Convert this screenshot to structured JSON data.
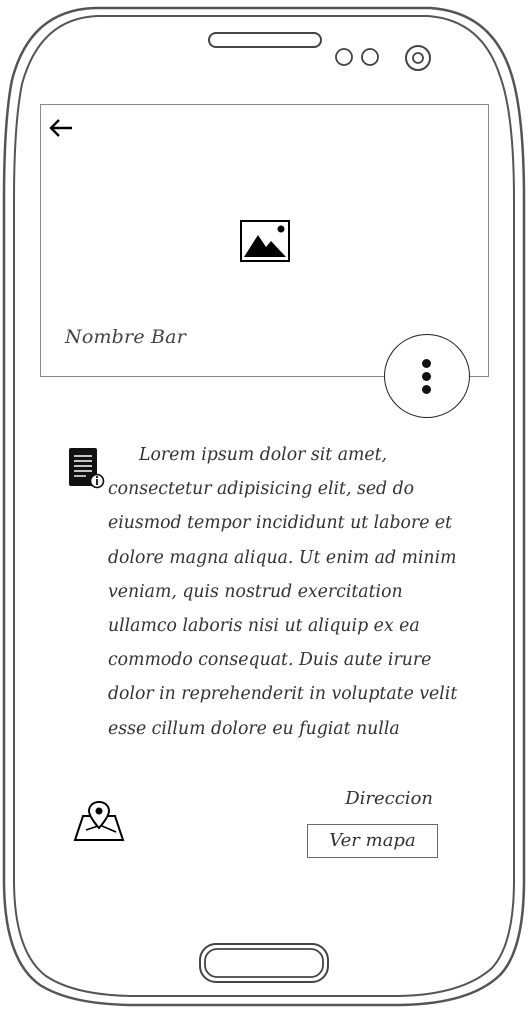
{
  "header": {
    "back_icon": "arrow-left-icon",
    "image_icon": "image-placeholder-icon",
    "title": "Nombre Bar"
  },
  "fab": {
    "icon": "more-vertical-icon"
  },
  "description": {
    "icon": "document-info-icon",
    "text": "Lorem ipsum dolor sit amet, consectetur adipisicing elit, sed do eiusmod tempor incididunt ut labore et dolore magna aliqua. Ut enim ad minim veniam, quis nostrud exercitation ullamco laboris nisi ut aliquip ex ea commodo consequat. Duis aute irure dolor in reprehenderit in voluptate velit esse cillum dolore eu fugiat nulla"
  },
  "location": {
    "icon": "map-pin-icon",
    "address_label": "Direccion",
    "map_button_label": "Ver mapa"
  },
  "device": {
    "speaker_icon": "speaker-slot-icon",
    "sensor_icon": "sensor-icon",
    "camera_icon": "front-camera-icon",
    "home_button_icon": "home-button-icon"
  }
}
